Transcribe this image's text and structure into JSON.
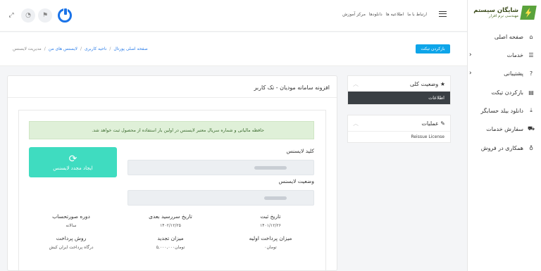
{
  "brand": {
    "name": "شایگان سیستم",
    "tagline": "مهندسی نرم افزار"
  },
  "sidebar": {
    "items": [
      {
        "label": "صفحه اصلی",
        "icon": "home-icon",
        "glyph": "⌂"
      },
      {
        "label": "خدمات",
        "icon": "list-icon",
        "glyph": "☰"
      },
      {
        "label": "پشتیبانی",
        "icon": "question-icon",
        "glyph": "?"
      },
      {
        "label": "بازکردن تیکت",
        "icon": "file-icon",
        "glyph": "▤"
      },
      {
        "label": "دانلود بیلد حسابگر",
        "icon": "download-icon",
        "glyph": "⤓"
      },
      {
        "label": "سفارش خدمات",
        "icon": "cart-icon",
        "glyph": "⛟"
      },
      {
        "label": "همکاری در فروش",
        "icon": "award-icon",
        "glyph": "♁"
      }
    ]
  },
  "topbar": {
    "links": [
      "ارتباط با ما",
      "اطلاعیه ها",
      "دانلودها",
      "مرکز آموزش"
    ]
  },
  "breadcrumb": {
    "items": [
      "صفحه اصلی پورتال",
      "ناحیه کاربری",
      "لایسنس های من",
      "مدیریت لایسنس"
    ],
    "separator": "/"
  },
  "open_ticket_button": "بازکردن تیکت",
  "widgets": {
    "status": {
      "title": "وضعیت کلی",
      "row": "اطلاعات"
    },
    "actions": {
      "title": "عملیات",
      "link": "Reissue License"
    }
  },
  "panel": {
    "title": "افزونه سامانه مودیان - تک کاربر",
    "alert": "حافظه مالیاتی و شماره سریال معتبر لایسنس در اولین بار استفاده از محصول ثبت خواهد شد.",
    "license_key_label": "کلید لایسنس",
    "license_status_label": "وضعیت لایسنس",
    "regen_button": "ایجاد مجدد لایسنس",
    "details": [
      {
        "label": "تاریخ ثبت",
        "value": "۱۴۰۱/۱۲/۲۶"
      },
      {
        "label": "تاریخ سررسید بعدی",
        "value": "۱۴۰۲/۱۲/۲۵"
      },
      {
        "label": "دوره صورتحساب",
        "value": "سالانه"
      },
      {
        "label": "میزان پرداخت اولیه",
        "value": "تومان۰"
      },
      {
        "label": "میزان تجدید",
        "value": "تومان۵,۰۰۰,۰۰۰"
      },
      {
        "label": "روش پرداخت",
        "value": "درگاه پرداخت ایران کیش"
      }
    ]
  },
  "colors": {
    "accent": "#0ea5e9",
    "regen": "#3fdcc0",
    "dark_row": "#3a3f44",
    "brand_green": "#5aa33c"
  }
}
